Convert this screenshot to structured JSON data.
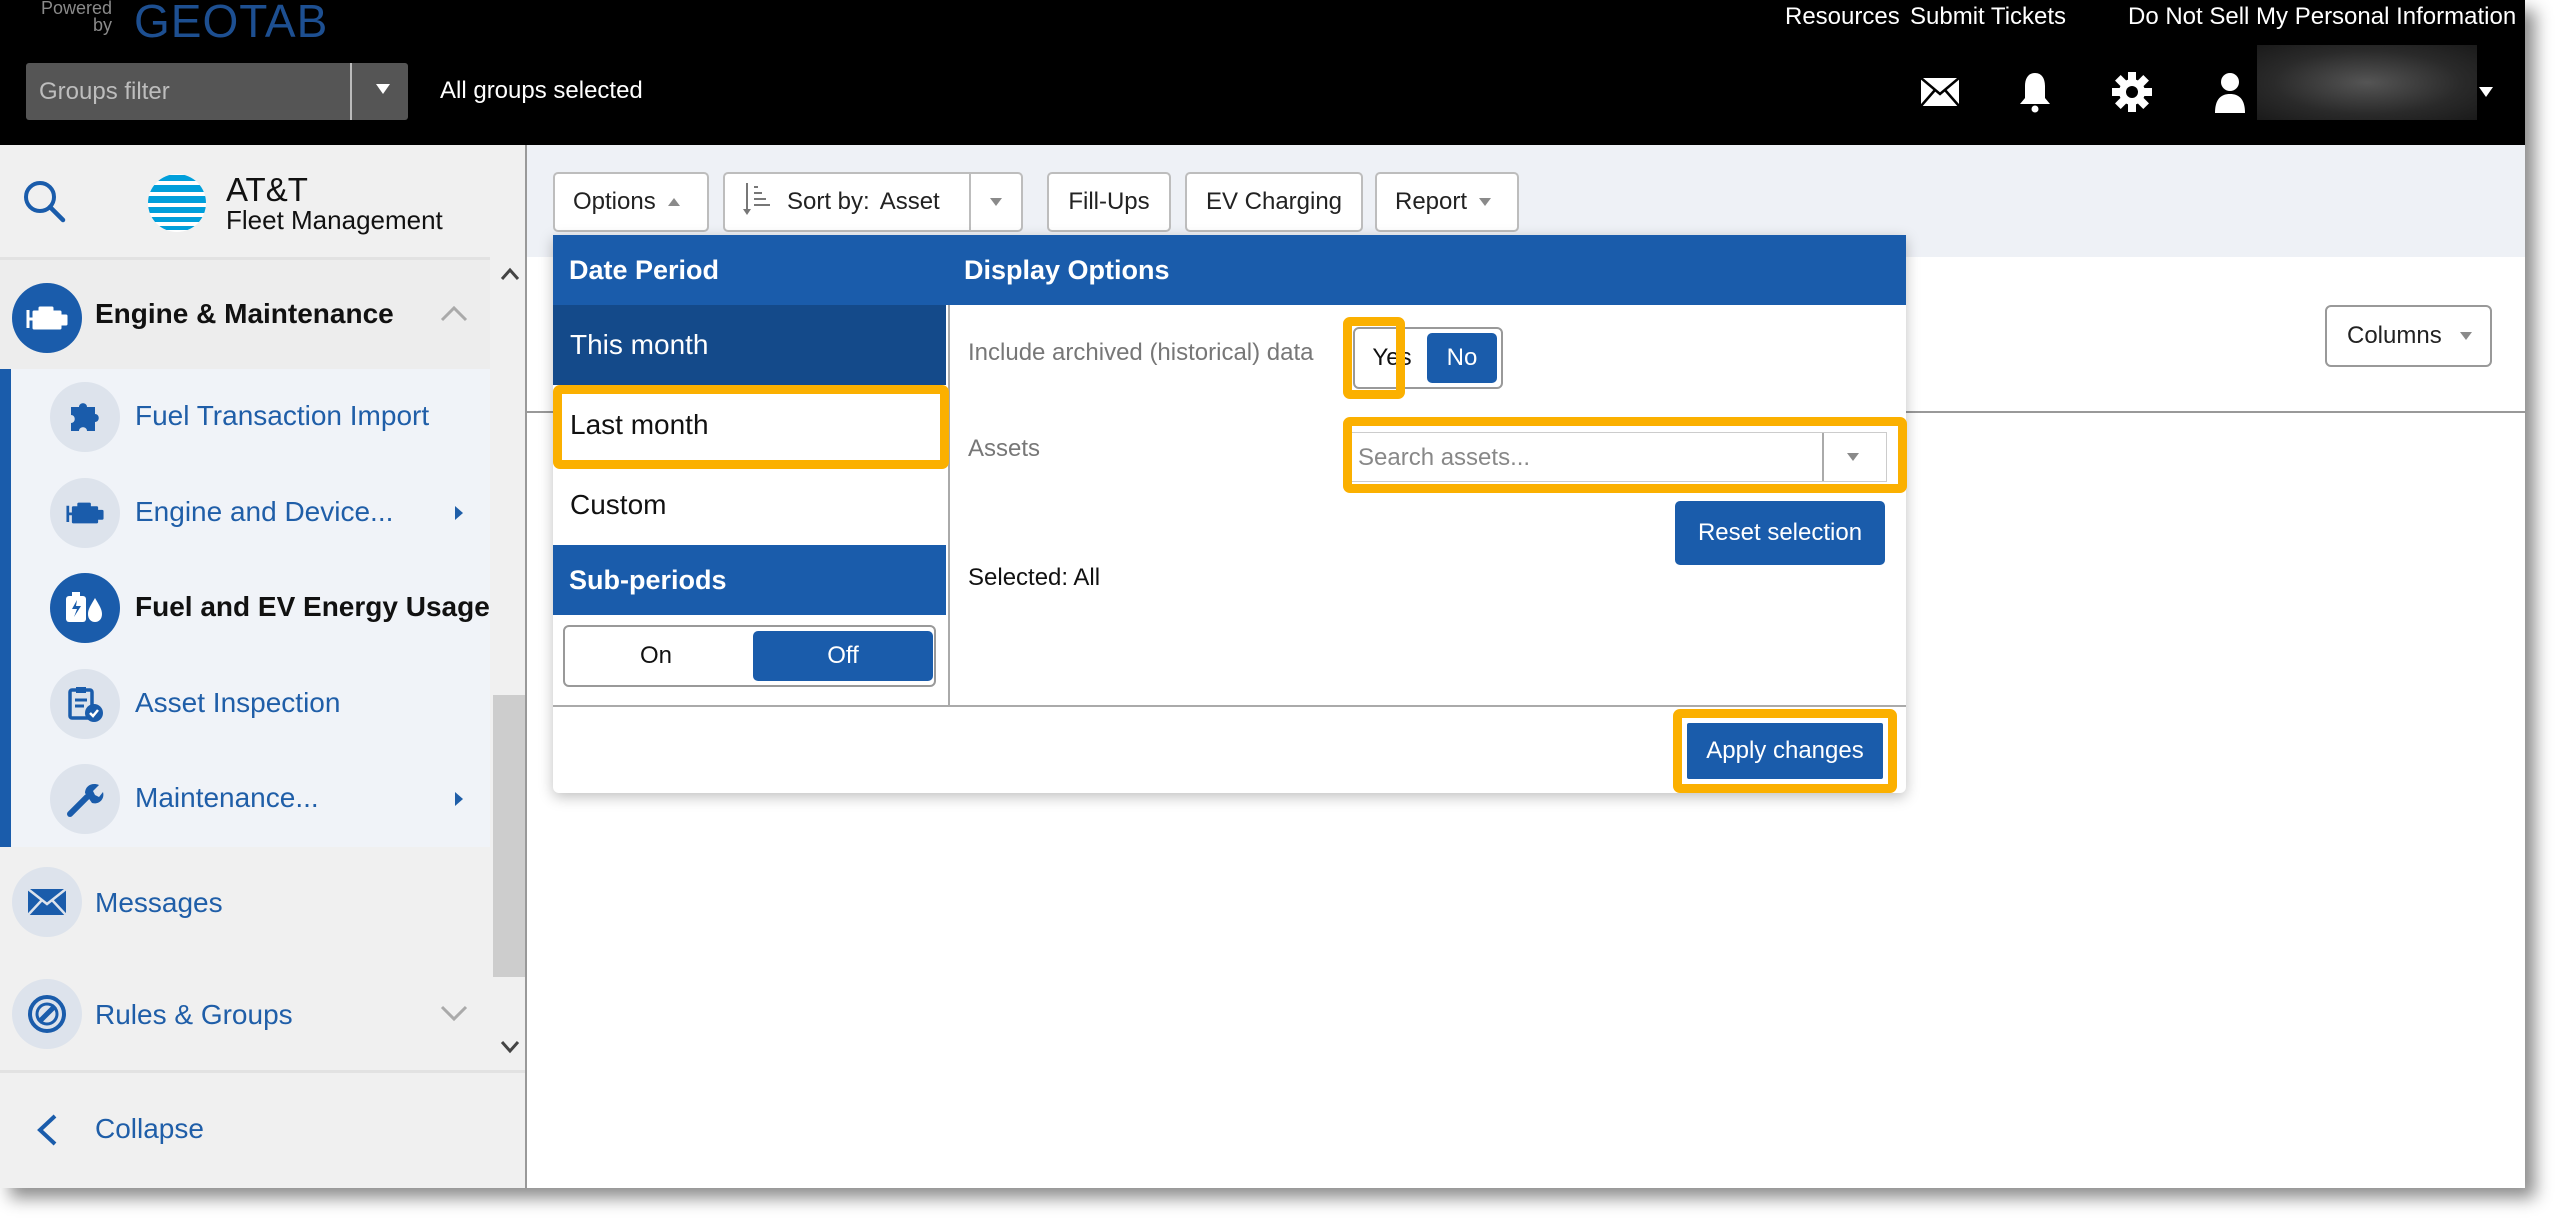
{
  "header": {
    "powered_by": "Powered by",
    "brand": "GEOTAB",
    "groups_filter_placeholder": "Groups filter",
    "groups_status": "All groups selected",
    "links": [
      "Resources",
      "Submit Tickets",
      "Do Not Sell My Personal Information"
    ],
    "icons": [
      "mail-icon",
      "bell-icon",
      "gear-icon",
      "user-icon"
    ]
  },
  "sidebar": {
    "logo_line1": "AT&T",
    "logo_line2": "Fleet Management",
    "group": {
      "label": "Engine & Maintenance",
      "expanded": true
    },
    "sub_items": [
      {
        "label": "Fuel Transaction Import",
        "icon": "puzzle-icon",
        "has_submenu": false,
        "active": false
      },
      {
        "label": "Engine and Device...",
        "icon": "engine-icon",
        "has_submenu": true,
        "active": false
      },
      {
        "label": "Fuel and EV Energy Usage",
        "icon": "fuel-ev-icon",
        "has_submenu": false,
        "active": true
      },
      {
        "label": "Asset Inspection",
        "icon": "clipboard-check-icon",
        "has_submenu": false,
        "active": false
      },
      {
        "label": "Maintenance...",
        "icon": "wrench-icon",
        "has_submenu": true,
        "active": false
      }
    ],
    "items": [
      {
        "label": "Messages",
        "icon": "envelope-icon"
      },
      {
        "label": "Rules & Groups",
        "icon": "rules-icon"
      }
    ],
    "collapse_label": "Collapse"
  },
  "toolbar": {
    "options_label": "Options",
    "sort_label": "Sort by:",
    "sort_value": "Asset",
    "fillups_label": "Fill-Ups",
    "ev_charging_label": "EV Charging",
    "report_label": "Report",
    "columns_label": "Columns"
  },
  "options_panel": {
    "date_period": {
      "title": "Date Period",
      "options": [
        "This month",
        "Last month",
        "Custom"
      ],
      "selected": "This month"
    },
    "sub_periods": {
      "title": "Sub-periods",
      "on_label": "On",
      "off_label": "Off",
      "selected": "Off"
    },
    "display_options": {
      "title": "Display Options",
      "archived_label": "Include archived (historical) data",
      "yes_label": "Yes",
      "no_label": "No",
      "archived_selected": "No",
      "assets_label": "Assets",
      "assets_placeholder": "Search assets...",
      "reset_label": "Reset selection",
      "selected_text": "Selected: All"
    },
    "apply_label": "Apply changes"
  },
  "colors": {
    "primary_blue": "#1a5cab",
    "selected_dark_blue": "#144a8a",
    "highlight_orange": "#fbb000",
    "header_black": "#000000"
  }
}
